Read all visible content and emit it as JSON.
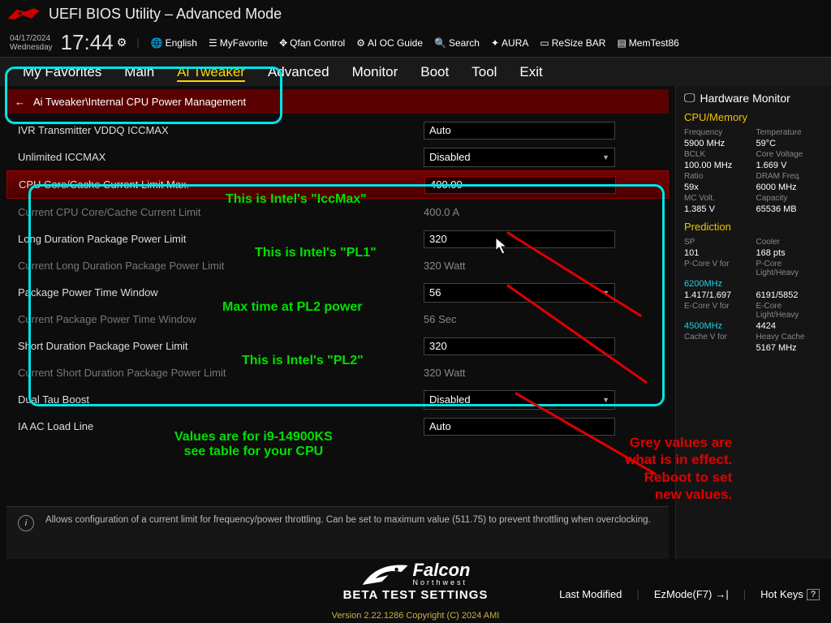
{
  "header": {
    "title": "UEFI BIOS Utility – Advanced Mode"
  },
  "datetime": {
    "date": "04/17/2024",
    "weekday": "Wednesday",
    "time": "17:44"
  },
  "toolbar": [
    {
      "id": "english",
      "icon": "🌐",
      "label": "English"
    },
    {
      "id": "myfav",
      "icon": "☰",
      "label": "MyFavorite"
    },
    {
      "id": "qfan",
      "icon": "✥",
      "label": "Qfan Control"
    },
    {
      "id": "aioc",
      "icon": "⚙",
      "label": "AI OC Guide"
    },
    {
      "id": "search",
      "icon": "🔍",
      "label": "Search"
    },
    {
      "id": "aura",
      "icon": "✦",
      "label": "AURA"
    },
    {
      "id": "resize",
      "icon": "▭",
      "label": "ReSize BAR"
    },
    {
      "id": "memtest",
      "icon": "▤",
      "label": "MemTest86"
    }
  ],
  "menu": [
    {
      "id": "myfav",
      "label": "My Favorites"
    },
    {
      "id": "main",
      "label": "Main"
    },
    {
      "id": "aitweaker",
      "label": "Ai Tweaker",
      "active": true
    },
    {
      "id": "advanced",
      "label": "Advanced"
    },
    {
      "id": "monitor",
      "label": "Monitor"
    },
    {
      "id": "boot",
      "label": "Boot"
    },
    {
      "id": "tool",
      "label": "Tool"
    },
    {
      "id": "exit",
      "label": "Exit"
    }
  ],
  "breadcrumb": {
    "path": "Ai Tweaker\\Internal CPU Power Management"
  },
  "rows": [
    {
      "type": "input",
      "label": "IVR Transmitter VDDQ ICCMAX",
      "value": "Auto"
    },
    {
      "type": "dd",
      "label": "Unlimited ICCMAX",
      "value": "Disabled"
    },
    {
      "type": "input",
      "label": "CPU Core/Cache Current Limit Max.",
      "value": "400.00",
      "selected": true
    },
    {
      "type": "ro",
      "label": "Current CPU Core/Cache Current Limit",
      "value": "400.0 A"
    },
    {
      "type": "input",
      "label": "Long Duration Package Power Limit",
      "value": "320"
    },
    {
      "type": "ro",
      "label": "Current Long Duration Package Power Limit",
      "value": "320 Watt"
    },
    {
      "type": "dd",
      "label": "Package Power Time Window",
      "value": "56"
    },
    {
      "type": "ro",
      "label": "Current Package Power Time Window",
      "value": "56 Sec"
    },
    {
      "type": "input",
      "label": "Short Duration Package Power Limit",
      "value": "320"
    },
    {
      "type": "ro",
      "label": "Current Short Duration Package Power Limit",
      "value": "320 Watt"
    },
    {
      "type": "dd",
      "label": "Dual Tau Boost",
      "value": "Disabled"
    },
    {
      "type": "input",
      "label": "IA AC Load Line",
      "value": "Auto"
    }
  ],
  "desc": "Allows configuration of a current limit for frequency/power throttling. Can be set to maximum value (511.75) to prevent throttling when overclocking.",
  "hw": {
    "title": "Hardware Monitor",
    "cpu": {
      "heading": "CPU/Memory",
      "freq_k": "Frequency",
      "freq_v": "5900 MHz",
      "temp_k": "Temperature",
      "temp_v": "59°C",
      "bclk_k": "BCLK",
      "bclk_v": "100.00 MHz",
      "cv_k": "Core Voltage",
      "cv_v": "1.669 V",
      "ratio_k": "Ratio",
      "ratio_v": "59x",
      "dram_k": "DRAM Freq.",
      "dram_v": "6000 MHz",
      "mcv_k": "MC Volt.",
      "mcv_v": "1.385 V",
      "cap_k": "Capacity",
      "cap_v": "65536 MB"
    },
    "pred": {
      "heading": "Prediction",
      "sp_k": "SP",
      "sp_v": "101",
      "cool_k": "Cooler",
      "cool_v": "168 pts",
      "pcv_k": "P-Core V for",
      "pcv_f": "6200MHz",
      "pcv_v": "1.417/1.697",
      "plh_k": "P-Core Light/Heavy",
      "plh_v": "6191/5852",
      "ecv_k": "E-Core V for",
      "ecv_f": "4500MHz",
      "ecv_v": "",
      "elh_k": "E-Core Light/Heavy",
      "elh_v": "4424",
      "cac_k": "Cache V for",
      "cac_v": "",
      "chc_k": "Heavy Cache",
      "chc_v": "5167 MHz"
    }
  },
  "footer": {
    "beta": "BETA TEST SETTINGS",
    "brand": "Falcon",
    "sub": "Northwest",
    "last": "Last Modified",
    "ez": "EzMode(F7)",
    "hot": "Hot Keys",
    "ver": "Version 2.22.1286 Copyright (C) 2024 AMI"
  },
  "anno": {
    "iccmax": "This is Intel's \"IccMax\"",
    "pl1": "This is Intel's \"PL1\"",
    "time": "Max time at PL2 power",
    "pl2": "This is Intel's \"PL2\"",
    "cpu": "Values are for i9-14900KS\nsee table for your CPU",
    "grey": "Grey values are\nwhat is in effect.\nReboot to set\nnew values."
  }
}
